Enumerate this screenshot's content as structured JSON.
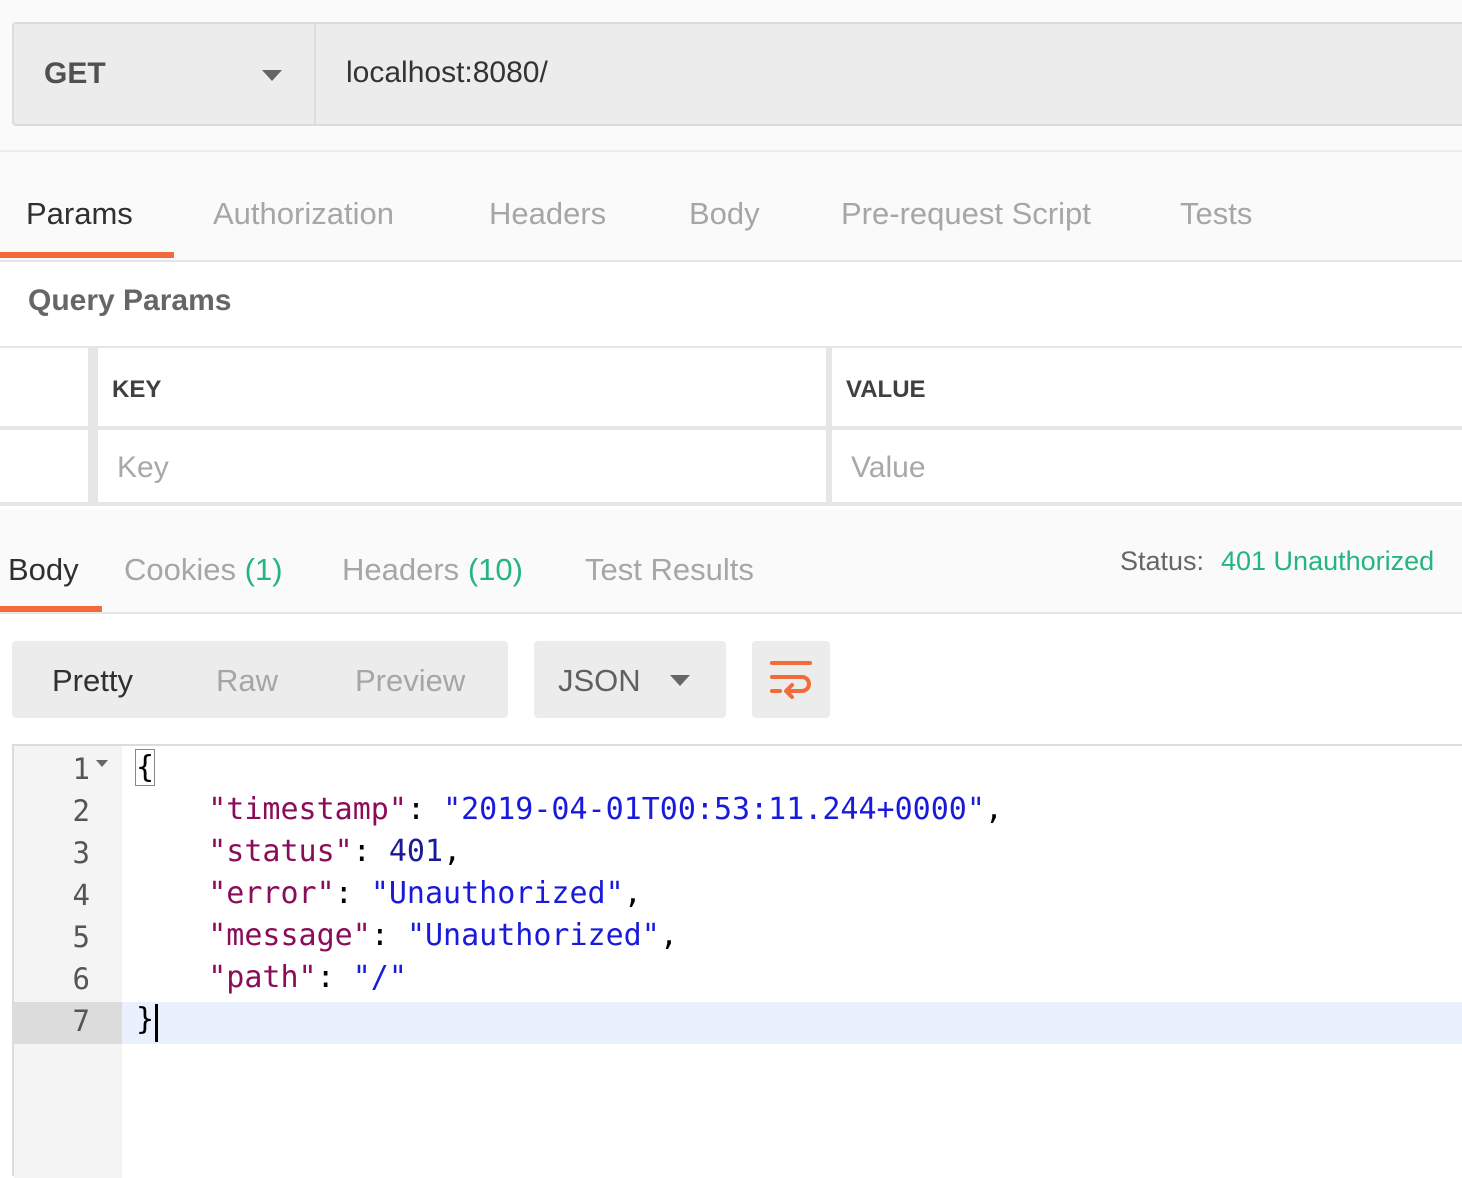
{
  "request": {
    "method": "GET",
    "url": "localhost:8080/"
  },
  "request_tabs": [
    {
      "label": "Params",
      "active": true
    },
    {
      "label": "Authorization",
      "active": false
    },
    {
      "label": "Headers",
      "active": false
    },
    {
      "label": "Body",
      "active": false
    },
    {
      "label": "Pre-request Script",
      "active": false
    },
    {
      "label": "Tests",
      "active": false
    }
  ],
  "query_params": {
    "title": "Query Params",
    "key_header": "KEY",
    "value_header": "VALUE",
    "key_placeholder": "Key",
    "value_placeholder": "Value"
  },
  "response_tabs": {
    "body": "Body",
    "cookies": "Cookies",
    "cookies_count": "(1)",
    "headers": "Headers",
    "headers_count": "(10)",
    "test_results": "Test Results"
  },
  "status": {
    "label": "Status:",
    "value": "401 Unauthorized"
  },
  "view_modes": {
    "pretty": "Pretty",
    "raw": "Raw",
    "preview": "Preview",
    "active": "Pretty"
  },
  "format": "JSON",
  "editor": {
    "line_numbers": [
      "1",
      "2",
      "3",
      "4",
      "5",
      "6",
      "7"
    ],
    "lines": {
      "l1": "{",
      "l2_key": "\"timestamp\"",
      "l2_val": "\"2019-04-01T00:53:11.244+0000\"",
      "l3_key": "\"status\"",
      "l3_val": "401",
      "l4_key": "\"error\"",
      "l4_val": "\"Unauthorized\"",
      "l5_key": "\"message\"",
      "l5_val": "\"Unauthorized\"",
      "l6_key": "\"path\"",
      "l6_val": "\"/\"",
      "l7": "}"
    }
  },
  "colors": {
    "accent": "#f26b3a",
    "status_ok": "#26b47f",
    "json_key": "#8b0d5a",
    "json_string": "#1a1adb"
  },
  "icons": {
    "method_dropdown": "caret-down-icon",
    "format_dropdown": "caret-down-icon",
    "wrap": "wrap-lines-icon",
    "fold": "fold-caret-icon"
  }
}
